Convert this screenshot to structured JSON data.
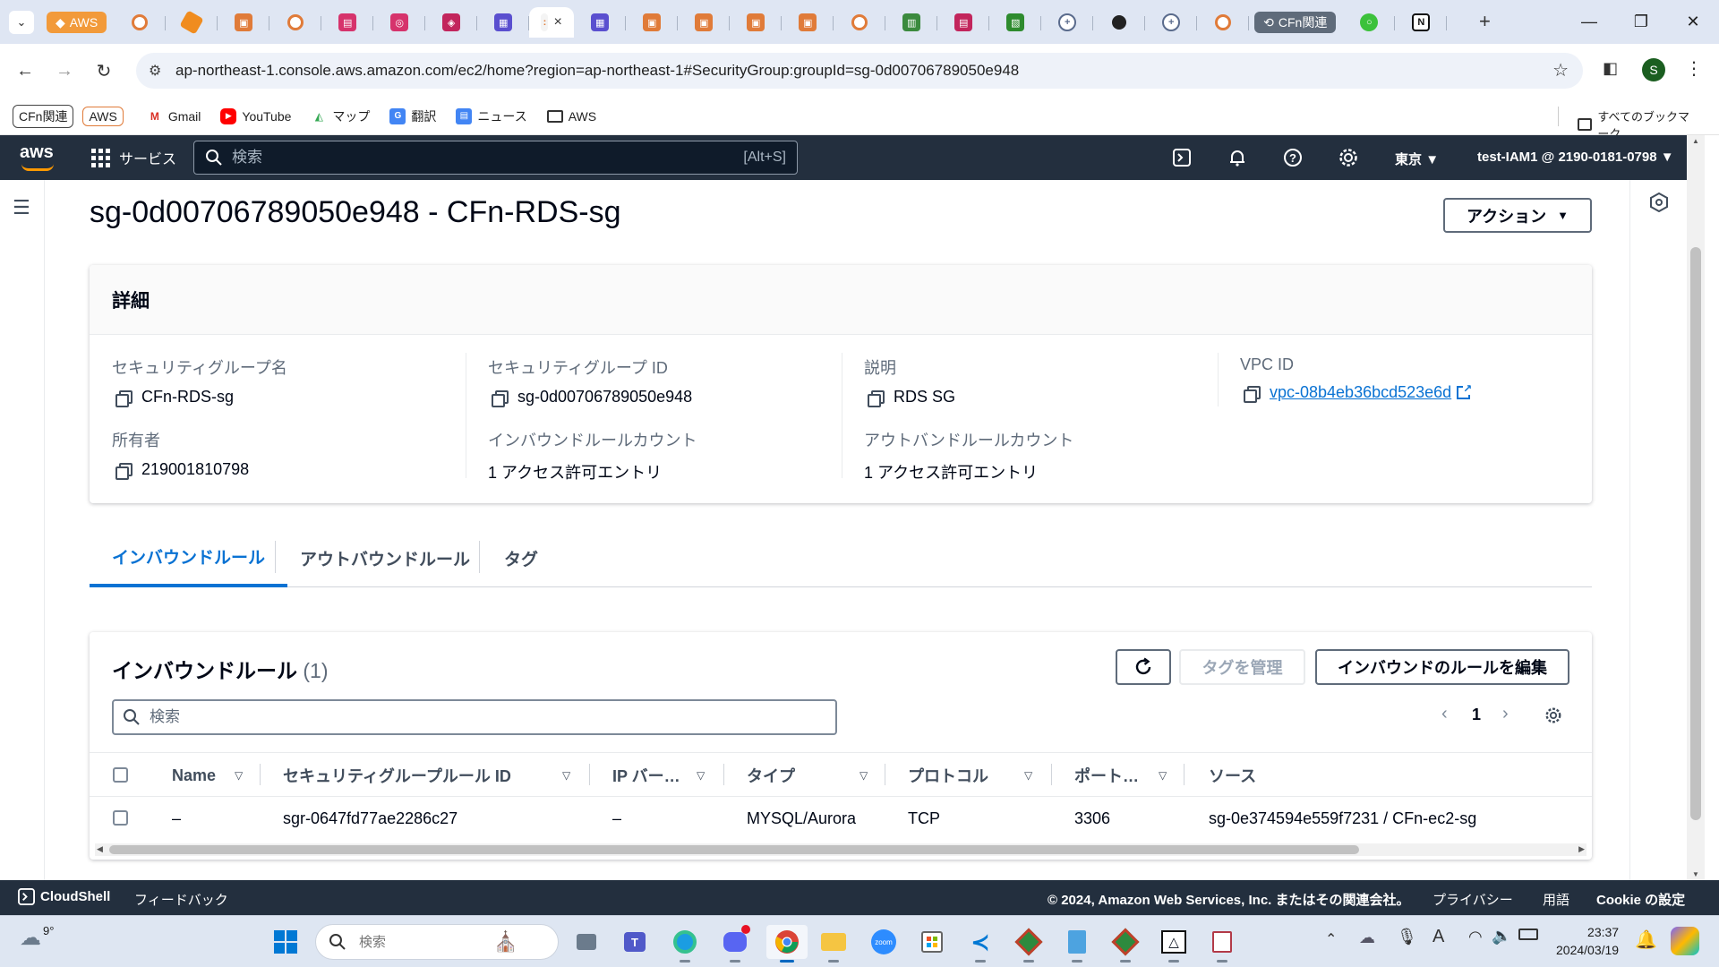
{
  "browser": {
    "tab_groups": {
      "aws": "AWS",
      "cfn": "CFn関連"
    },
    "active_tab_close": "×",
    "url": "ap-northeast-1.console.aws.amazon.com/ec2/home?region=ap-northeast-1#SecurityGroup:groupId=sg-0d00706789050e948",
    "profile_initial": "S",
    "bookmarks": {
      "tag1": "CFn関連",
      "tag2": "AWS",
      "gmail": "Gmail",
      "youtube": "YouTube",
      "maps": "マップ",
      "translate": "翻訳",
      "news": "ニュース",
      "aws_folder": "AWS",
      "all_bookmarks": "すべてのブックマーク"
    }
  },
  "aws_header": {
    "logo": "aws",
    "services": "サービス",
    "search_placeholder": "検索",
    "search_shortcut": "[Alt+S]",
    "region": "東京",
    "account": "test-IAM1 @ 2190-0181-0798"
  },
  "page": {
    "title": "sg-0d00706789050e948 - CFn-RDS-sg",
    "actions_button": "アクション"
  },
  "details": {
    "heading": "詳細",
    "fields": {
      "sg_name_label": "セキュリティグループ名",
      "sg_name_value": "CFn-RDS-sg",
      "sg_id_label": "セキュリティグループ ID",
      "sg_id_value": "sg-0d00706789050e948",
      "description_label": "説明",
      "description_value": "RDS SG",
      "vpc_label": "VPC ID",
      "vpc_value": "vpc-08b4eb36bcd523e6d",
      "owner_label": "所有者",
      "owner_value": "219001810798",
      "inbound_count_label": "インバウンドルールカウント",
      "inbound_count_value": "1 アクセス許可エントリ",
      "outbound_count_label": "アウトバンドルールカウント",
      "outbound_count_value": "1 アクセス許可エントリ"
    }
  },
  "tabs": {
    "inbound": "インバウンドルール",
    "outbound": "アウトバウンドルール",
    "tags": "タグ"
  },
  "inbound_table": {
    "title": "インバウンドルール",
    "count": "(1)",
    "manage_tags": "タグを管理",
    "edit_rules": "インバウンドのルールを編集",
    "search_placeholder": "検索",
    "page_number": "1",
    "columns": {
      "name": "Name",
      "rule_id": "セキュリティグループルール ID",
      "ip_version": "IP バー…",
      "type": "タイプ",
      "protocol": "プロトコル",
      "port": "ポート…",
      "source": "ソース"
    },
    "rows": [
      {
        "name": "–",
        "rule_id": "sgr-0647fd77ae2286c27",
        "ip_version": "–",
        "type": "MYSQL/Aurora",
        "protocol": "TCP",
        "port": "3306",
        "source": "sg-0e374594e559f7231 / CFn-ec2-sg"
      }
    ]
  },
  "footer": {
    "cloudshell": "CloudShell",
    "feedback": "フィードバック",
    "copyright": "© 2024, Amazon Web Services, Inc. またはその関連会社。",
    "privacy": "プライバシー",
    "terms": "用語",
    "cookies": "Cookie の設定"
  },
  "taskbar": {
    "weather": "9°",
    "search_placeholder": "検索",
    "time": "23:37",
    "date": "2024/03/19"
  },
  "colors": {
    "aws_navy": "#232f3e",
    "aws_orange": "#ff9900",
    "link_blue": "#0972d3"
  }
}
